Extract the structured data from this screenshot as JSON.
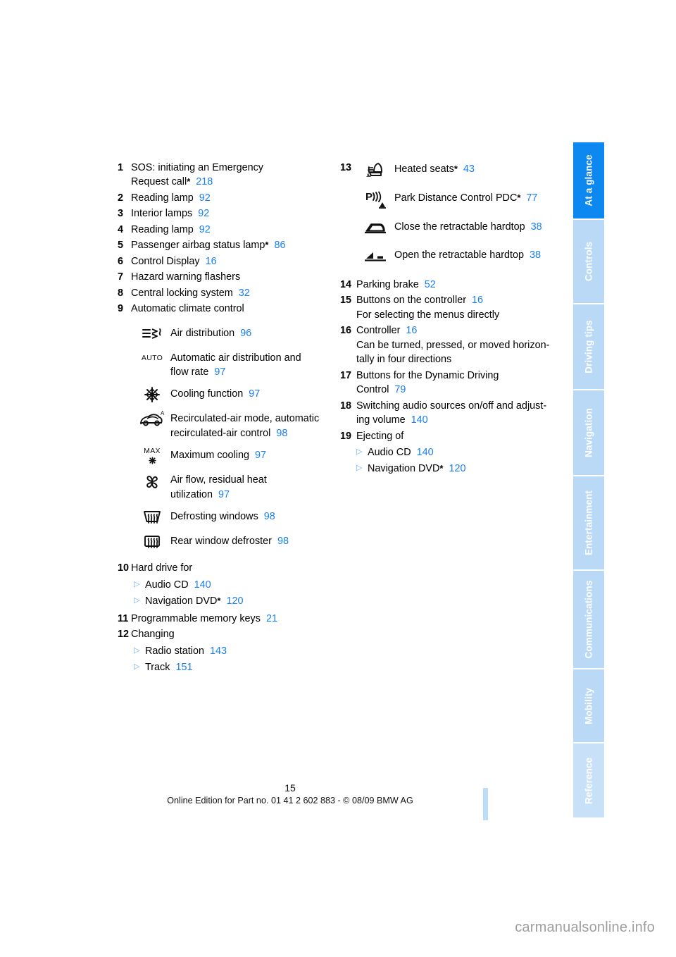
{
  "sidebar": {
    "tabs": [
      {
        "label": "At a glance",
        "state": "active"
      },
      {
        "label": "Controls",
        "state": "normal"
      },
      {
        "label": "Driving tips",
        "state": "normal"
      },
      {
        "label": "Navigation",
        "state": "normal"
      },
      {
        "label": "Entertainment",
        "state": "normal"
      },
      {
        "label": "Communications",
        "state": "normal"
      },
      {
        "label": "Mobility",
        "state": "normal"
      },
      {
        "label": "Reference",
        "state": "faded"
      }
    ]
  },
  "left_column": {
    "items": [
      {
        "num": "1",
        "line1": "SOS: initiating an Emergency",
        "line2": "Request call",
        "star": "*",
        "page": "218"
      },
      {
        "num": "2",
        "line1": "Reading lamp",
        "page": "92"
      },
      {
        "num": "3",
        "line1": "Interior lamps",
        "page": "92"
      },
      {
        "num": "4",
        "line1": "Reading lamp",
        "page": "92"
      },
      {
        "num": "5",
        "line1": "Passenger airbag status lamp",
        "star": "*",
        "page": "86"
      },
      {
        "num": "6",
        "line1": "Control Display",
        "page": "16"
      },
      {
        "num": "7",
        "line1": "Hazard warning flashers",
        "page": ""
      },
      {
        "num": "8",
        "line1": "Central locking system",
        "page": "32"
      },
      {
        "num": "9",
        "line1": "Automatic climate control",
        "page": ""
      }
    ],
    "climate_icons": [
      {
        "icon": "air-distribution-icon",
        "label": "Air distribution",
        "page": "96"
      },
      {
        "icon": "auto-climate-icon",
        "label": "Automatic air distribution and",
        "label2": "flow rate",
        "page": "97"
      },
      {
        "icon": "snowflake-cooling-icon",
        "label": "Cooling function",
        "page": "97"
      },
      {
        "icon": "recirculated-air-icon",
        "label": "Recirculated-air mode, automatic",
        "label2": "recirculated-air control",
        "page": "98"
      },
      {
        "icon": "max-cooling-icon",
        "label": "Maximum cooling",
        "page": "97"
      },
      {
        "icon": "fan-airflow-icon",
        "label": "Air flow, residual heat",
        "label2": "utilization",
        "page": "97"
      },
      {
        "icon": "windshield-defrost-icon",
        "label": "Defrosting windows",
        "page": "98"
      },
      {
        "icon": "rear-window-defroster-icon",
        "label": "Rear window defroster",
        "page": "98"
      }
    ],
    "items_tail": [
      {
        "num": "10",
        "line1": "Hard drive for",
        "page": "",
        "subs": [
          {
            "label": "Audio CD",
            "page": "140"
          },
          {
            "label": "Navigation DVD",
            "star": "*",
            "page": "120"
          }
        ]
      },
      {
        "num": "11",
        "line1": "Programmable memory keys",
        "page": "21"
      },
      {
        "num": "12",
        "line1": "Changing",
        "page": "",
        "subs": [
          {
            "label": "Radio station",
            "page": "143"
          },
          {
            "label": "Track",
            "page": "151"
          }
        ]
      }
    ]
  },
  "right_column": {
    "group13": {
      "num": "13",
      "icons": [
        {
          "icon": "heated-seats-icon",
          "label": "Heated seats",
          "star": "*",
          "page": "43"
        },
        {
          "icon": "park-distance-control-icon",
          "label": "Park Distance Control PDC",
          "star": "*",
          "page": "77"
        },
        {
          "icon": "close-hardtop-icon",
          "label": "Close the retractable hardtop",
          "page": "38"
        },
        {
          "icon": "open-hardtop-icon",
          "label": "Open the retractable hardtop",
          "page": "38"
        }
      ]
    },
    "items": [
      {
        "num": "14",
        "line1": "Parking brake",
        "page": "52"
      },
      {
        "num": "15",
        "line1": "Buttons on the controller",
        "page": "16",
        "line2": "For selecting the menus directly"
      },
      {
        "num": "16",
        "line1": "Controller",
        "page": "16",
        "line2": "Can be turned, pressed, or moved horizon-",
        "line3": "tally in four directions"
      },
      {
        "num": "17",
        "line1": "Buttons for the Dynamic Driving",
        "line2b": "Control",
        "page": "79"
      },
      {
        "num": "18",
        "line1": "Switching audio sources on/off and adjust-",
        "line2b": "ing volume",
        "page": "140"
      },
      {
        "num": "19",
        "line1": "Ejecting of",
        "page": "",
        "subs": [
          {
            "label": "Audio CD",
            "page": "140"
          },
          {
            "label": "Navigation DVD",
            "star": "*",
            "page": "120"
          }
        ]
      }
    ]
  },
  "footer": {
    "page_number": "15",
    "edition_line": "Online Edition for Part no. 01 41 2 602 883 - © 08/09 BMW AG"
  },
  "watermark": {
    "text": "carmanualsonline.info"
  },
  "colors": {
    "accent_blue": "#1a7ff0",
    "tab_active": "#0d88f0",
    "tab_inactive": "#b9d9f7"
  }
}
